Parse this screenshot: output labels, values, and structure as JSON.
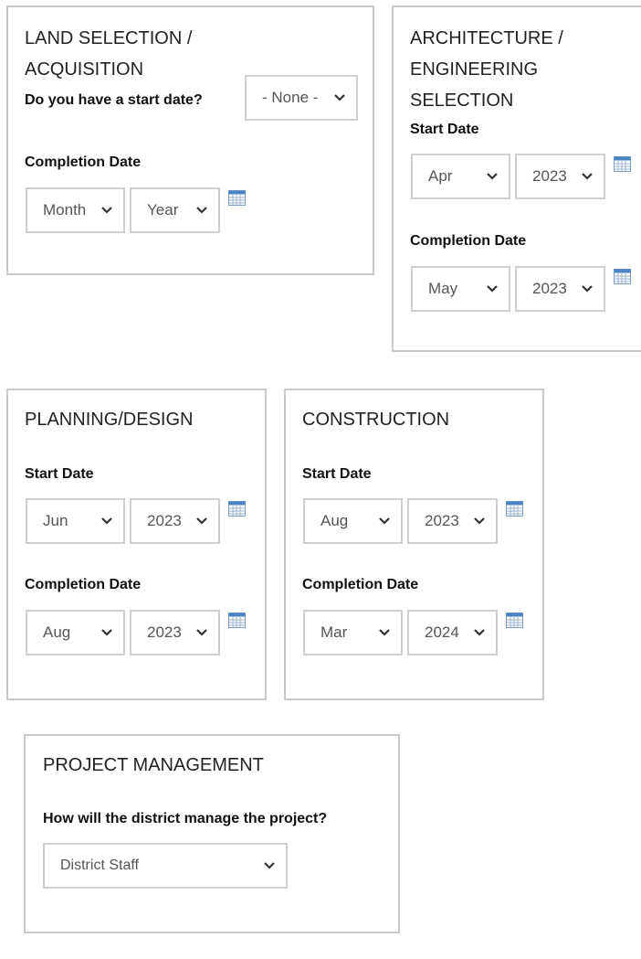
{
  "colors": {
    "panel_border": "#c9c9c9",
    "select_border": "#cfcfcf",
    "calendar_header": "#4a84c6"
  },
  "land": {
    "title_line1": "LAND SELECTION /",
    "title_line2": "ACQUISITION",
    "question": "Do you have a start date?",
    "start_select": "- None -",
    "completion_label": "Completion Date",
    "completion_month": "Month",
    "completion_year": "Year"
  },
  "architecture": {
    "title_line1": "ARCHITECTURE /",
    "title_line2": "ENGINEERING",
    "title_line3": "SELECTION",
    "start_label": "Start Date",
    "start_month": "Apr",
    "start_year": "2023",
    "completion_label": "Completion Date",
    "completion_month": "May",
    "completion_year": "2023"
  },
  "planning": {
    "title": "PLANNING/DESIGN",
    "start_label": "Start Date",
    "start_month": "Jun",
    "start_year": "2023",
    "completion_label": "Completion Date",
    "completion_month": "Aug",
    "completion_year": "2023"
  },
  "construction": {
    "title": "CONSTRUCTION",
    "start_label": "Start Date",
    "start_month": "Aug",
    "start_year": "2023",
    "completion_label": "Completion Date",
    "completion_month": "Mar",
    "completion_year": "2024"
  },
  "project_management": {
    "title": "PROJECT MANAGEMENT",
    "question": "How will the district manage the project?",
    "manager_select": "District Staff"
  },
  "icons": {
    "chevron": "chevron-down-icon",
    "calendar": "calendar-icon"
  }
}
